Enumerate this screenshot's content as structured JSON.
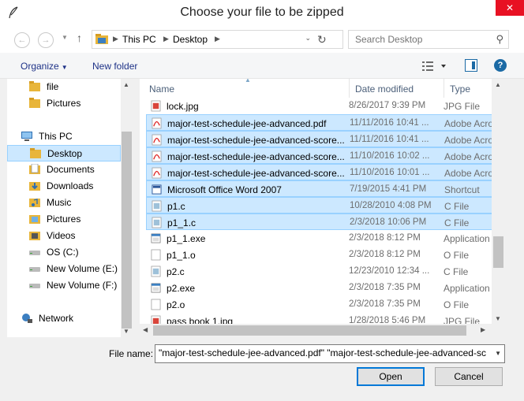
{
  "window": {
    "title": "Choose your file to be zipped",
    "close_glyph": "✕"
  },
  "nav": {
    "back_glyph": "←",
    "forward_glyph": "→",
    "up_glyph": "↑",
    "breadcrumb": [
      "This PC",
      "Desktop"
    ],
    "refresh_glyph": "↻",
    "search_placeholder": "Search Desktop"
  },
  "toolbar": {
    "organize_label": "Organize",
    "new_folder_label": "New folder",
    "help_glyph": "?"
  },
  "sidebar": {
    "items": [
      {
        "label": "file",
        "icon": "folder-icon"
      },
      {
        "label": "Pictures",
        "icon": "folder-icon"
      },
      {
        "label": "This PC",
        "icon": "computer-icon"
      },
      {
        "label": "Desktop",
        "icon": "folder-icon",
        "selected": true
      },
      {
        "label": "Documents",
        "icon": "documents-icon"
      },
      {
        "label": "Downloads",
        "icon": "downloads-icon"
      },
      {
        "label": "Music",
        "icon": "music-icon"
      },
      {
        "label": "Pictures",
        "icon": "pictures-icon"
      },
      {
        "label": "Videos",
        "icon": "videos-icon"
      },
      {
        "label": "OS (C:)",
        "icon": "drive-icon"
      },
      {
        "label": "New Volume (E:)",
        "icon": "drive-icon"
      },
      {
        "label": "New Volume (F:)",
        "icon": "drive-icon"
      },
      {
        "label": "Network",
        "icon": "network-icon"
      }
    ]
  },
  "files": {
    "columns": {
      "name": "Name",
      "date": "Date modified",
      "type": "Type"
    },
    "rows": [
      {
        "name": "lock.jpg",
        "date": "8/26/2017 9:39 PM",
        "type": "JPG File",
        "icon": "image-file-icon",
        "selected": false
      },
      {
        "name": "major-test-schedule-jee-advanced.pdf",
        "date": "11/11/2016 10:41 ...",
        "type": "Adobe Acrobat",
        "icon": "pdf-file-icon",
        "selected": true
      },
      {
        "name": "major-test-schedule-jee-advanced-score...",
        "date": "11/11/2016 10:41 ...",
        "type": "Adobe Acrobat",
        "icon": "pdf-file-icon",
        "selected": true
      },
      {
        "name": "major-test-schedule-jee-advanced-score...",
        "date": "11/10/2016 10:02 ...",
        "type": "Adobe Acrobat",
        "icon": "pdf-file-icon",
        "selected": true
      },
      {
        "name": "major-test-schedule-jee-advanced-score...",
        "date": "11/10/2016 10:01 ...",
        "type": "Adobe Acrobat",
        "icon": "pdf-file-icon",
        "selected": true
      },
      {
        "name": "Microsoft Office Word 2007",
        "date": "7/19/2015 4:41 PM",
        "type": "Shortcut",
        "icon": "shortcut-file-icon",
        "selected": true
      },
      {
        "name": "p1.c",
        "date": "10/28/2010 4:08 PM",
        "type": "C File",
        "icon": "c-file-icon",
        "selected": true
      },
      {
        "name": "p1_1.c",
        "date": "2/3/2018 10:06 PM",
        "type": "C File",
        "icon": "c-file-icon",
        "selected": true
      },
      {
        "name": "p1_1.exe",
        "date": "2/3/2018 8:12 PM",
        "type": "Application",
        "icon": "exe-file-icon",
        "selected": false
      },
      {
        "name": "p1_1.o",
        "date": "2/3/2018 8:12 PM",
        "type": "O File",
        "icon": "blank-file-icon",
        "selected": false
      },
      {
        "name": "p2.c",
        "date": "12/23/2010 12:34 ...",
        "type": "C File",
        "icon": "c-file-icon",
        "selected": false
      },
      {
        "name": "p2.exe",
        "date": "2/3/2018 7:35 PM",
        "type": "Application",
        "icon": "exe-file-icon",
        "selected": false
      },
      {
        "name": "p2.o",
        "date": "2/3/2018 7:35 PM",
        "type": "O File",
        "icon": "blank-file-icon",
        "selected": false
      },
      {
        "name": "pass book 1.jpg",
        "date": "1/28/2018 5:46 PM",
        "type": "JPG File",
        "icon": "image-file-icon",
        "selected": false
      }
    ]
  },
  "filename": {
    "label": "File name:",
    "value": "\"major-test-schedule-jee-advanced.pdf\" \"major-test-schedule-jee-advanced-sc"
  },
  "buttons": {
    "open": "Open",
    "cancel": "Cancel"
  }
}
